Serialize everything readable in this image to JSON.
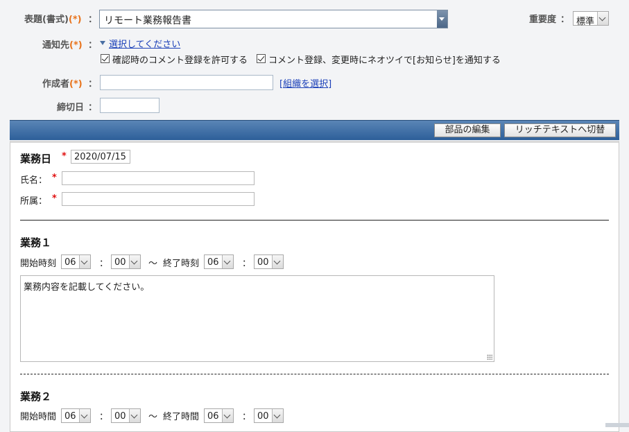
{
  "form": {
    "title_label": "表題(書式)",
    "title_req": "(*)",
    "title_value": "リモート業務報告書",
    "importance_label": "重要度",
    "importance_value": "標準",
    "notify_label": "通知先",
    "notify_req": "(*)",
    "notify_select_link": "選択してください",
    "check1": "確認時のコメント登録を許可する",
    "check2": "コメント登録、変更時にネオツイで[お知らせ]を通知する",
    "author_label": "作成者",
    "author_req": "(*)",
    "author_org_link": "[組織を選択]",
    "deadline_label": "締切日",
    "colon": "："
  },
  "toolbar": {
    "edit_parts": "部品の編集",
    "switch_rich": "リッチテキストへ切替"
  },
  "editor": {
    "work_day_label": "業務日",
    "asterisk": "*",
    "work_day_value": "2020/07/15",
    "name_label": "氏名：",
    "dept_label": "所属：",
    "task1": {
      "title": "業務１",
      "start_label": "開始時刻",
      "start_h": "06",
      "start_m": "00",
      "tilde": "～",
      "end_label": "終了時刻",
      "end_h": "06",
      "end_m": "00",
      "sep": "：",
      "content": "業務内容を記載してください。"
    },
    "task2": {
      "title": "業務２",
      "start_label": "開始時間",
      "start_h": "06",
      "start_m": "00",
      "tilde": "～",
      "end_label": "終了時間",
      "end_h": "06",
      "end_m": "00",
      "sep": "："
    }
  }
}
